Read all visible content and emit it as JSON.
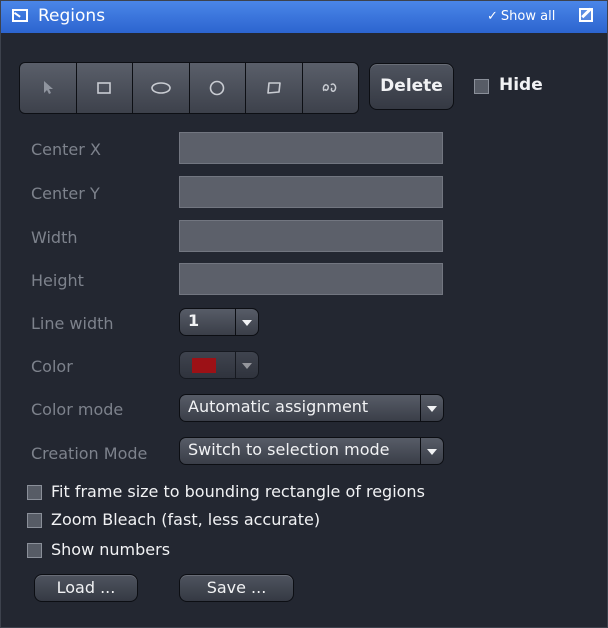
{
  "header": {
    "title": "Regions",
    "show_all": "Show all"
  },
  "tools": [
    {
      "icon": "arrow-pointer-icon"
    },
    {
      "icon": "rectangle-icon"
    },
    {
      "icon": "ellipse-icon"
    },
    {
      "icon": "circle-icon"
    },
    {
      "icon": "closed-bezier-icon"
    },
    {
      "icon": "freehand-icon"
    }
  ],
  "delete_label": "Delete",
  "hide_label": "Hide",
  "fields": {
    "center_x": {
      "label": "Center X",
      "value": ""
    },
    "center_y": {
      "label": "Center Y",
      "value": ""
    },
    "width": {
      "label": "Width",
      "value": ""
    },
    "height": {
      "label": "Height",
      "value": ""
    }
  },
  "line_width": {
    "label": "Line width",
    "value": "1"
  },
  "color": {
    "label": "Color",
    "value": "#ff0000"
  },
  "color_mode": {
    "label": "Color mode",
    "value": "Automatic assignment"
  },
  "creation_mode": {
    "label": "Creation Mode",
    "value": "Switch to selection mode"
  },
  "options": {
    "fit_frame": "Fit frame size to bounding rectangle of regions",
    "zoom_bleach": "Zoom Bleach (fast, less accurate)",
    "show_numbers": "Show numbers"
  },
  "load_label": "Load ...",
  "save_label": "Save ...",
  "colors": {
    "header": "#2c64cf",
    "panel": "#232731",
    "accent_red": "#ff0000"
  }
}
